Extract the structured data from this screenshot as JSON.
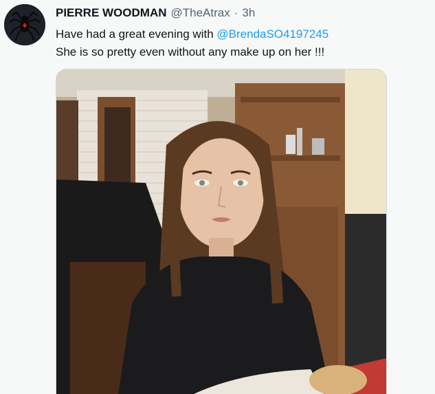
{
  "tweet": {
    "author": {
      "display_name": "PIERRE WOODMAN",
      "handle": "@TheAtrax",
      "avatar_icon": "spider-avatar-icon"
    },
    "separator": "·",
    "time": "3h",
    "text": {
      "line1_prefix": "Have had a great evening with ",
      "mention": "@BrendaSO4197245",
      "line2": "She is so pretty even without any make up on her !!!"
    },
    "media": {
      "kind": "photo"
    }
  },
  "colors": {
    "link": "#1d9bf0",
    "name_text": "#0f1419",
    "meta_text": "#536471",
    "background": "#f7f9f9"
  }
}
